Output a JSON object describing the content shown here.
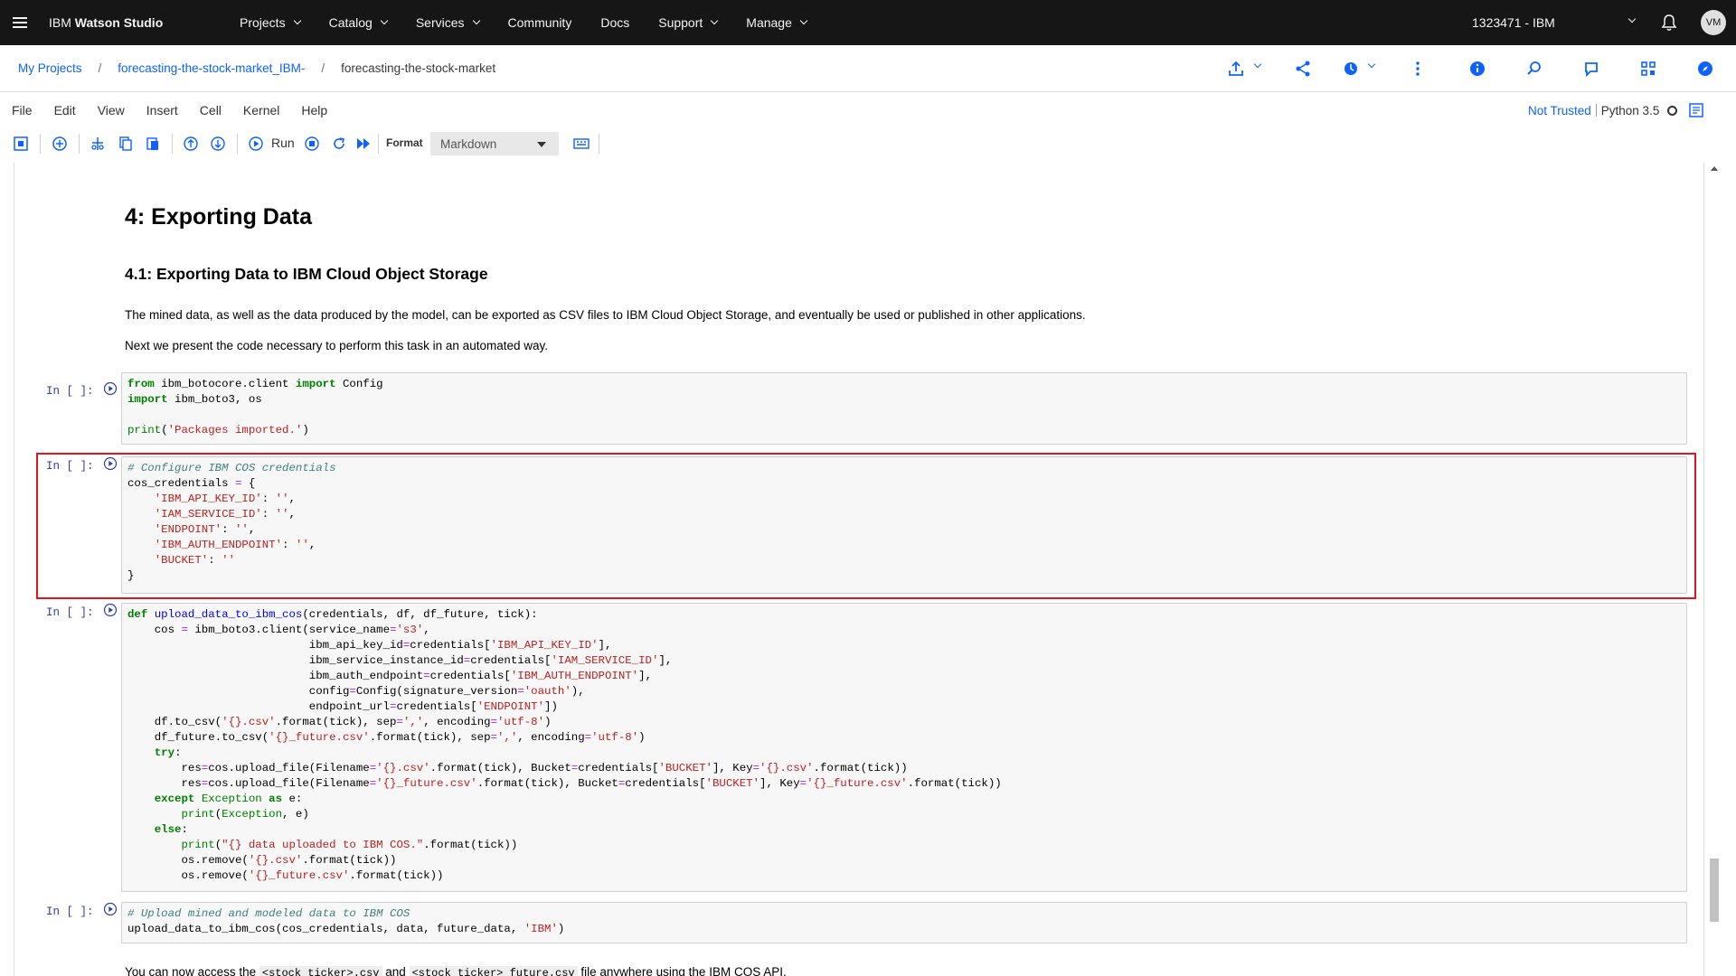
{
  "header": {
    "brand_prefix": "IBM",
    "brand_name": "Watson Studio",
    "nav": [
      "Projects",
      "Catalog",
      "Services",
      "Community",
      "Docs",
      "Support",
      "Manage"
    ],
    "nav_has_dropdown": [
      true,
      true,
      true,
      false,
      false,
      true,
      true
    ],
    "account": "1323471 - IBM",
    "avatar_initials": "VM"
  },
  "breadcrumb": {
    "items": [
      "My Projects",
      "forecasting-the-stock-market_IBM-",
      "forecasting-the-stock-market"
    ],
    "separator": "/"
  },
  "menu": [
    "File",
    "Edit",
    "View",
    "Insert",
    "Cell",
    "Kernel",
    "Help"
  ],
  "kernel": {
    "trust": "Not Trusted",
    "name": "Python 3.5"
  },
  "toolbar": {
    "run_label": "Run",
    "format_label": "Format",
    "format_value": "Markdown"
  },
  "notebook": {
    "heading1": "4: Exporting Data",
    "heading2": "4.1: Exporting Data to IBM Cloud Object Storage",
    "para1": "The mined data, as well as the data produced by the model, can be exported as CSV files to IBM Cloud Object Storage, and eventually be used or published in other applications.",
    "para2": "Next we present the code necessary to perform this task in an automated way.",
    "prompt": "In [ ]:",
    "footer_pre": "You can now access the",
    "footer_code1": "<stock_ticker>.csv",
    "footer_mid": "and",
    "footer_code2": "<stock_ticker>_future.csv",
    "footer_post": "file anywhere using the IBM COS API."
  },
  "colors": {
    "topbar": "#161616",
    "link": "#0f62fe",
    "selection": "#e0151e",
    "prompt": "#303f9f"
  }
}
